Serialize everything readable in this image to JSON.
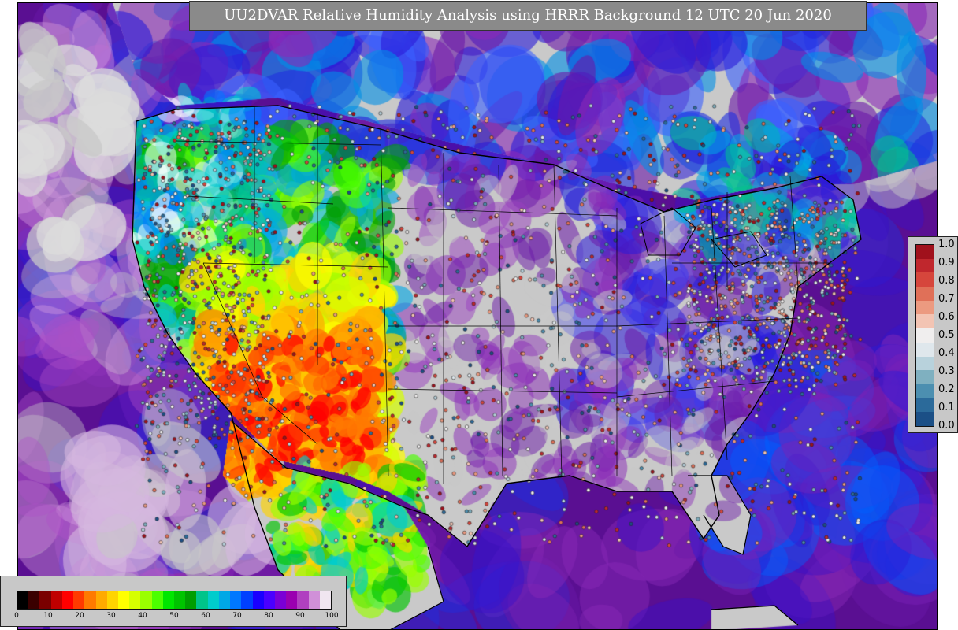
{
  "title": "UU2DVAR Relative Humidity Analysis using HRRR Background 12 UTC 20 Jun 2020",
  "observation_legend": {
    "ticks": [
      "1.0",
      "0.9",
      "0.8",
      "0.7",
      "0.6",
      "0.5",
      "0.4",
      "0.3",
      "0.2",
      "0.1",
      "0.0"
    ],
    "colors": [
      "#a0111c",
      "#c0272d",
      "#d6463c",
      "#e07058",
      "#ec9a80",
      "#f3c4b3",
      "#f0eeee",
      "#dfe7ec",
      "#b8d2dc",
      "#7fb0c0",
      "#4c8fb0",
      "#2b6a9a",
      "#1b4f86"
    ]
  },
  "humidity_scale": {
    "ticks": [
      "0",
      "10",
      "20",
      "30",
      "40",
      "50",
      "60",
      "70",
      "80",
      "90",
      "100"
    ],
    "colors": [
      "#000000",
      "#3a0000",
      "#7a0000",
      "#c00000",
      "#ff0000",
      "#ff3a00",
      "#ff7a00",
      "#ffaa00",
      "#ffd400",
      "#ffff00",
      "#d6ff00",
      "#9aff00",
      "#4cff00",
      "#00e600",
      "#00c400",
      "#009e00",
      "#00c48a",
      "#00cccc",
      "#00a8e6",
      "#0078ff",
      "#0040ff",
      "#1a00ff",
      "#4a00ff",
      "#7a00d6",
      "#9a00b0",
      "#b040c0",
      "#d090d8",
      "#f0e6f0"
    ]
  },
  "colors": {
    "panel": "#c8c8c8",
    "title_bg": "#8a8a8a",
    "land_dry": "#c9c9c9",
    "ocean": "#5a0f92"
  }
}
